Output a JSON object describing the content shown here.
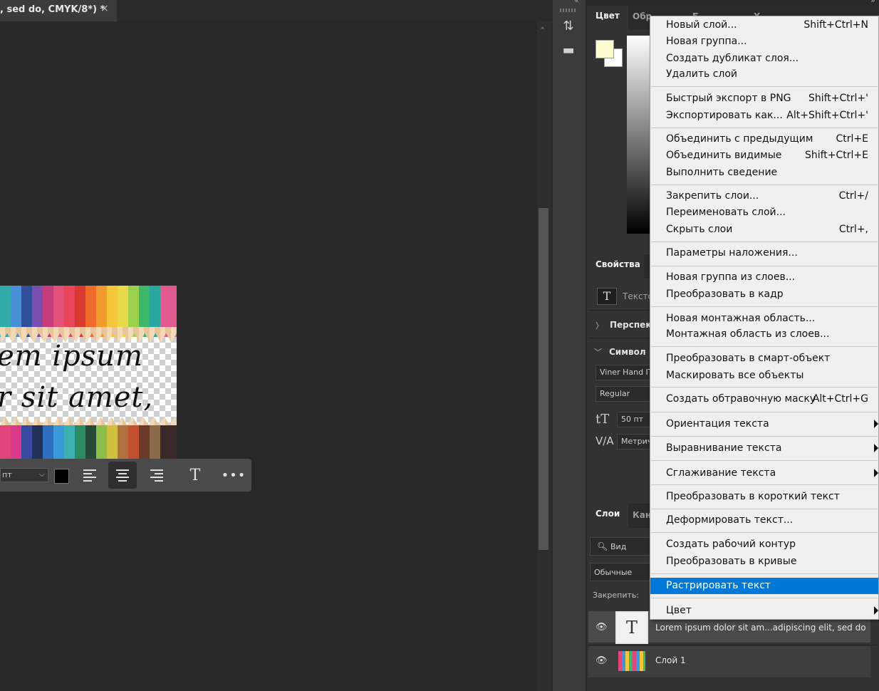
{
  "document_tab": {
    "title": ", sed do, CMYK/8*) *",
    "close_glyph": "×"
  },
  "canvas": {
    "line1": "em ipsum",
    "line2": "r sit amet,"
  },
  "text_toolbar": {
    "size_value": "пт",
    "dropdown_glyph": "⌵",
    "color": "#000000",
    "more_glyph": "•••",
    "transform_glyph": "T"
  },
  "icon_strip": {
    "collapse_left": "«",
    "collapse_right": "»",
    "history_glyph": "⇅",
    "comments_glyph": "▬"
  },
  "color_panel": {
    "tabs": [
      "Цвет",
      "Обр",
      "Б",
      "Х"
    ],
    "foreground": "#fffdd0",
    "background": "#ffffff"
  },
  "properties_panel": {
    "tab": "Свойства",
    "type_icon": "T",
    "type_label": "Текстовый слой",
    "perspective_label": "Перспектива",
    "symbol_label": "Символ",
    "font_family": "Viner Hand ITC",
    "font_style": "Regular",
    "font_size": "50 пт",
    "kerning": "Метрические",
    "size_icon": "tT",
    "kern_icon": "V/A"
  },
  "layers_panel": {
    "tabs": [
      "Слои",
      "Каналы"
    ],
    "search_label": "Вид",
    "blend_mode": "Обычные",
    "lock_label": "Закрепить:",
    "layers": [
      {
        "name": "Lorem ipsum dolor sit am...adipiscing elit, sed do",
        "thumb": "T"
      },
      {
        "name": "Слой 1"
      }
    ]
  },
  "context_menu": {
    "items": [
      {
        "label": "Новый слой...",
        "shortcut": "Shift+Ctrl+N"
      },
      {
        "label": "Новая группа...",
        "shortcut": ""
      },
      {
        "label": "Создать дубликат слоя...",
        "shortcut": ""
      },
      {
        "label": "Удалить слой",
        "shortcut": ""
      },
      {
        "label": "Быстрый экспорт в PNG",
        "shortcut": "Shift+Ctrl+'"
      },
      {
        "label": "Экспортировать как...",
        "shortcut": "Alt+Shift+Ctrl+'"
      },
      {
        "label": "Объединить с предыдущим",
        "shortcut": "Ctrl+E"
      },
      {
        "label": "Объединить видимые",
        "shortcut": "Shift+Ctrl+E"
      },
      {
        "label": "Выполнить сведение",
        "shortcut": ""
      },
      {
        "label": "Закрепить слои...",
        "shortcut": "Ctrl+/"
      },
      {
        "label": "Переименовать слой...",
        "shortcut": ""
      },
      {
        "label": "Скрыть слои",
        "shortcut": "Ctrl+,"
      },
      {
        "label": "Параметры наложения...",
        "shortcut": ""
      },
      {
        "label": "Новая группа из слоев...",
        "shortcut": ""
      },
      {
        "label": "Преобразовать в кадр",
        "shortcut": ""
      },
      {
        "label": "Новая монтажная область...",
        "shortcut": ""
      },
      {
        "label": "Монтажная область из слоев...",
        "shortcut": ""
      },
      {
        "label": "Преобразовать в смарт-объект",
        "shortcut": ""
      },
      {
        "label": "Маскировать все объекты",
        "shortcut": ""
      },
      {
        "label": "Создать обтравочную маску",
        "shortcut": "Alt+Ctrl+G"
      },
      {
        "label": "Ориентация текста",
        "shortcut": ""
      },
      {
        "label": "Выравнивание текста",
        "shortcut": ""
      },
      {
        "label": "Сглаживание текста",
        "shortcut": ""
      },
      {
        "label": "Преобразовать в короткий текст",
        "shortcut": ""
      },
      {
        "label": "Деформировать текст...",
        "shortcut": ""
      },
      {
        "label": "Создать рабочий контур",
        "shortcut": ""
      },
      {
        "label": "Преобразовать в кривые",
        "shortcut": ""
      },
      {
        "label": "Растрировать текст",
        "shortcut": ""
      },
      {
        "label": "Цвет",
        "shortcut": ""
      }
    ]
  }
}
